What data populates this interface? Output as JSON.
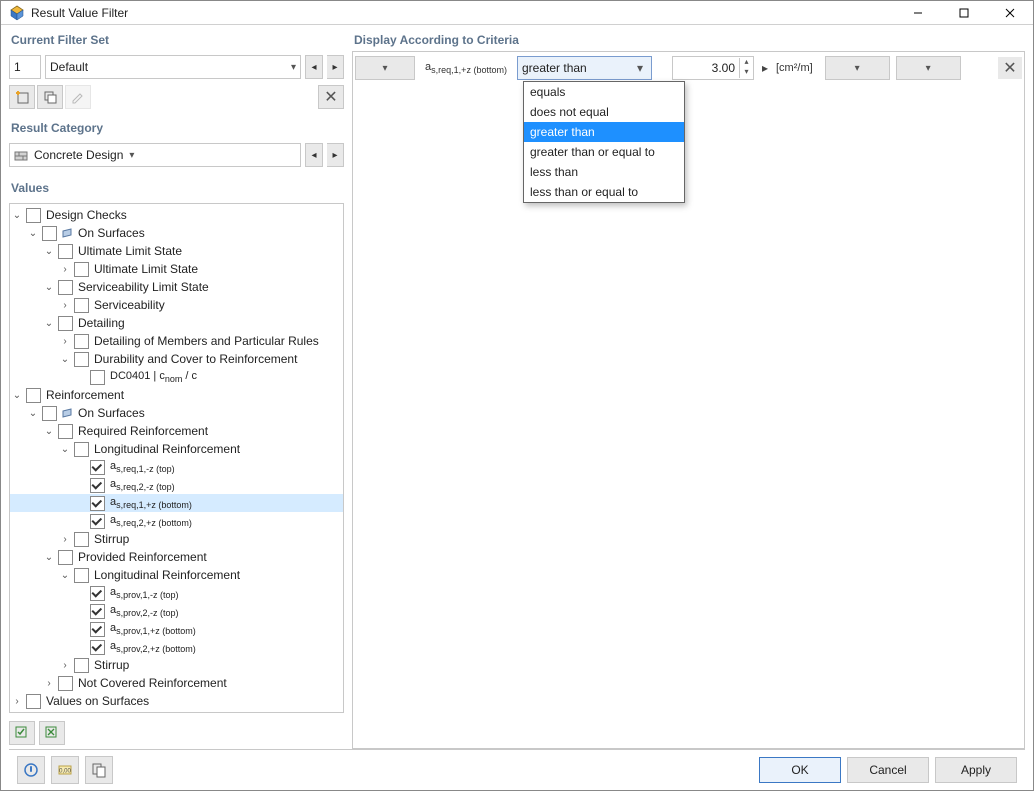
{
  "window": {
    "title": "Result Value Filter"
  },
  "filterSet": {
    "heading": "Current Filter Set",
    "index": "1",
    "name": "Default"
  },
  "category": {
    "heading": "Result Category",
    "name": "Concrete Design"
  },
  "valuesHeading": "Values",
  "tree": {
    "designChecks": "Design Checks",
    "onSurfaces": "On Surfaces",
    "uls": "Ultimate Limit State",
    "ulsChild": "Ultimate Limit State",
    "sls": "Serviceability Limit State",
    "slsChild": "Serviceability",
    "detailing": "Detailing",
    "detChild": "Detailing of Members and Particular Rules",
    "durability": "Durability and Cover to Reinforcement",
    "dc0401a": "DC0401 | c",
    "dc0401b": " / c",
    "dc0401nom": "nom",
    "reinforcement": "Reinforcement",
    "required": "Required Reinforcement",
    "longitudinal": "Longitudinal Reinforcement",
    "a_req1mz": "s,req,1,-z (top)",
    "a_req2mz": "s,req,2,-z (top)",
    "a_req1pz": "s,req,1,+z (bottom)",
    "a_req2pz": "s,req,2,+z (bottom)",
    "stirrup": "Stirrup",
    "provided": "Provided Reinforcement",
    "a_prov1mz": "s,prov,1,-z (top)",
    "a_prov2mz": "s,prov,2,-z (top)",
    "a_prov1pz": "s,prov,1,+z (bottom)",
    "a_prov2pz": "s,prov,2,+z (bottom)",
    "notCovered": "Not Covered Reinforcement",
    "valuesOnSurf": "Values on Surfaces"
  },
  "criteria": {
    "heading": "Display According to Criteria",
    "param": "s,req,1,+z (bottom)",
    "operator": "greater than",
    "value": "3.00",
    "unit": "[cm²/m]",
    "options": {
      "eq": "equals",
      "neq": "does not equal",
      "gt": "greater than",
      "gte": "greater than or equal to",
      "lt": "less than",
      "lte": "less than or equal to"
    }
  },
  "footer": {
    "ok": "OK",
    "cancel": "Cancel",
    "apply": "Apply"
  }
}
